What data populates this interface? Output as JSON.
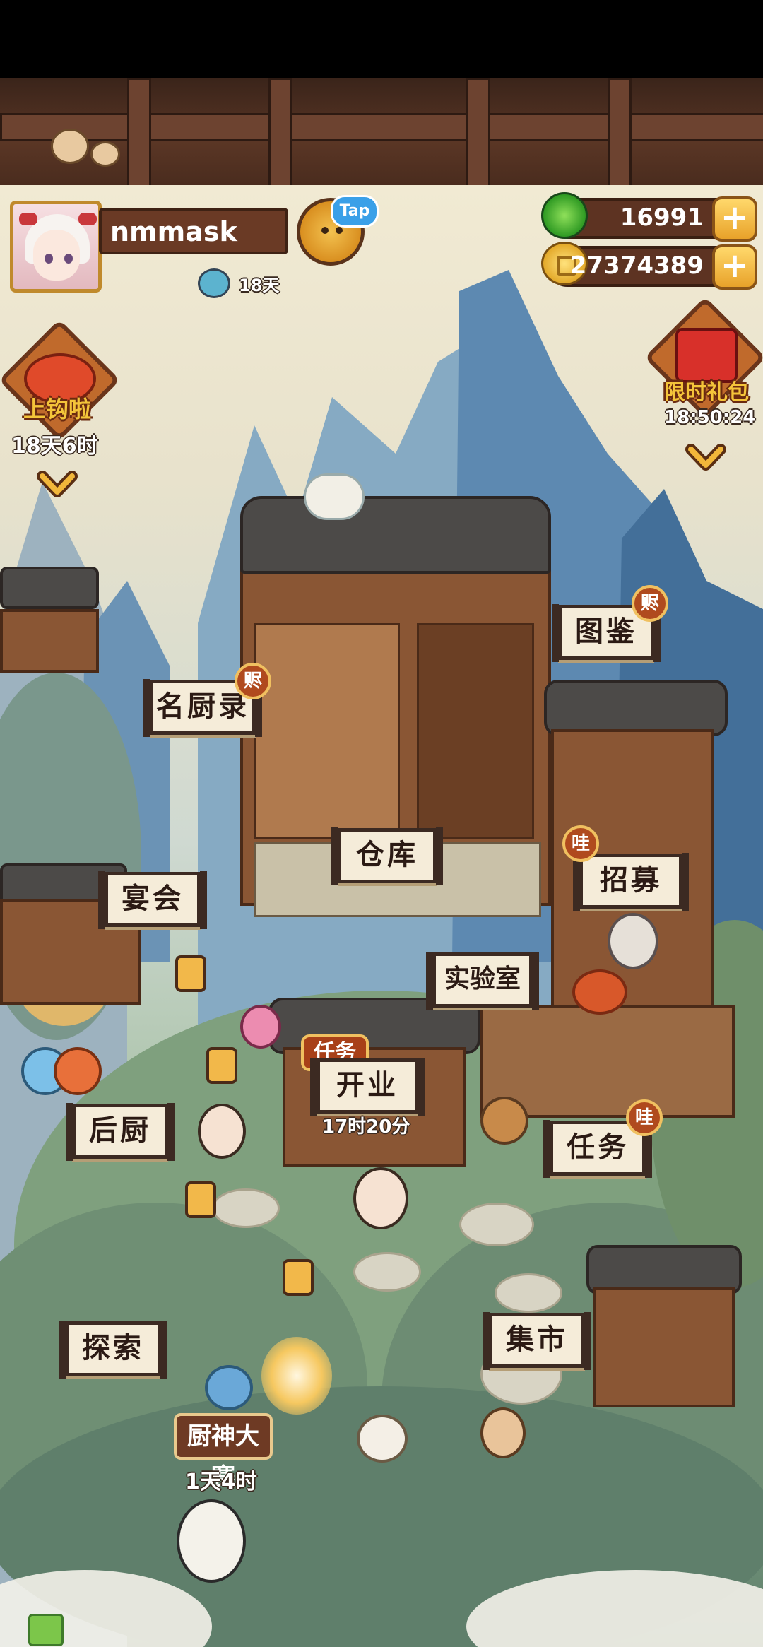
{
  "player": {
    "name": "nmmask",
    "days": "18天",
    "tap_label": "Tap"
  },
  "currencies": {
    "apples": "16991",
    "coins": "27374389",
    "add_label": "+"
  },
  "events": {
    "fishing": {
      "label": "上钩啦",
      "timer": "18天6时"
    },
    "gift_pack": {
      "label": "限时礼包",
      "timer": "18:50:24"
    },
    "chef_contest": {
      "label": "厨神大赛",
      "timer": "1天4时"
    }
  },
  "buildings": {
    "catalog": {
      "label": "图鉴",
      "badge": "赆"
    },
    "famous_chefs": {
      "label": "名厨录",
      "badge": "赆"
    },
    "warehouse": {
      "label": "仓库"
    },
    "recruit": {
      "label": "招募",
      "badge": "哇"
    },
    "banquet": {
      "label": "宴会"
    },
    "lab": {
      "label": "实验室"
    },
    "open_business": {
      "label": "开业",
      "tag": "任务",
      "timer": "17时20分"
    },
    "back_kitchen": {
      "label": "后厨"
    },
    "tasks": {
      "label": "任务",
      "badge": "哇"
    },
    "explore": {
      "label": "探索"
    },
    "market": {
      "label": "集市"
    }
  },
  "colors": {
    "sign_bg": "#f5ecd9",
    "sign_border": "#3c2a22",
    "badge_red": "#b04a1e",
    "gold": "#f0c060",
    "wood": "#8a5634"
  },
  "icons": [
    "apple-icon",
    "coin-icon",
    "plus-icon",
    "chevron-down-icon",
    "koi-fish-icon",
    "gift-box-icon",
    "chick-icon",
    "bottle-icon"
  ]
}
